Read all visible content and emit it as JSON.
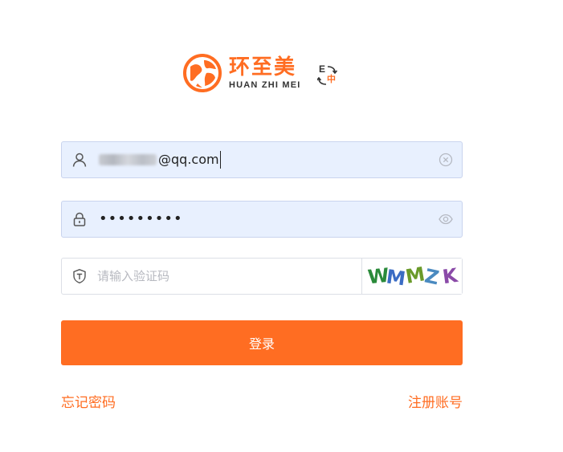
{
  "brand": {
    "name_cn": "环至美",
    "name_en": "HUAN ZHI MEI",
    "color": "#ff6d22"
  },
  "language_switch": {
    "icon": "language-switch-icon",
    "en_glyph": "E",
    "zh_glyph": "中"
  },
  "username": {
    "icon": "user-icon",
    "value_visible": "@qq.com",
    "clear_icon": "clear-circle-icon"
  },
  "password": {
    "icon": "lock-icon",
    "masked_value": "•••••••••",
    "toggle_icon": "eye-icon"
  },
  "captcha": {
    "icon": "shield-icon",
    "placeholder": "请输入验证码",
    "code": "WMMZK"
  },
  "login_button": {
    "label": "登录"
  },
  "links": {
    "forgot_password": "忘记密码",
    "register": "注册账号"
  }
}
